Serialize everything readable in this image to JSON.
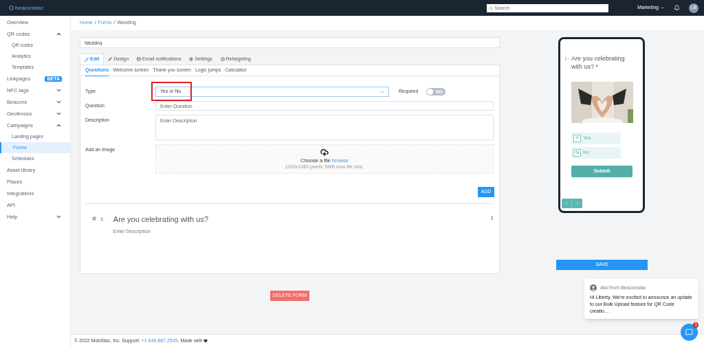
{
  "header": {
    "logo": "beaconstac",
    "search": {
      "placeholder": "Search"
    },
    "account": "Marketing",
    "avatar": "LB"
  },
  "sidebar": {
    "items": [
      {
        "label": "Overview",
        "selected": false
      },
      {
        "label": "QR codes",
        "selected": false,
        "expanded": true,
        "children": [
          {
            "label": "QR codes",
            "selected": false
          },
          {
            "label": "Analytics",
            "selected": false
          },
          {
            "label": "Templates",
            "selected": false
          }
        ]
      },
      {
        "label": "Linkpages",
        "selected": false,
        "badge": "BETA"
      },
      {
        "label": "NFC tags",
        "selected": false,
        "expanded": false
      },
      {
        "label": "Beacons",
        "selected": false,
        "expanded": false
      },
      {
        "label": "Geofences",
        "selected": false,
        "expanded": false
      },
      {
        "label": "Campaigns",
        "selected": false,
        "expanded": true,
        "children": [
          {
            "label": "Landing pages",
            "selected": false
          },
          {
            "label": "Forms",
            "selected": true
          },
          {
            "label": "Schedules",
            "selected": false
          }
        ]
      },
      {
        "label": "Asset library",
        "selected": false
      },
      {
        "label": "Places",
        "selected": false
      },
      {
        "label": "Integrations",
        "selected": false
      },
      {
        "label": "API",
        "selected": false
      },
      {
        "label": "Help",
        "selected": false,
        "expanded": false
      }
    ]
  },
  "breadcrumb": [
    {
      "label": "Home",
      "link": true
    },
    {
      "label": "/",
      "link": false
    },
    {
      "label": "Forms",
      "link": true
    },
    {
      "label": "/",
      "link": false
    },
    {
      "label": "Wedding",
      "link": false
    }
  ],
  "form_title": {
    "value": "Wedding"
  },
  "tabs": [
    {
      "label": "Edit",
      "selected": true
    },
    {
      "label": "Design",
      "selected": false
    },
    {
      "label": "Email notifications",
      "selected": false
    },
    {
      "label": "Settings",
      "selected": false
    },
    {
      "label": "Retargeting",
      "selected": false
    }
  ],
  "subtabs": [
    {
      "label": "Questions",
      "selected": true
    },
    {
      "label": "Welcome screen",
      "selected": false
    },
    {
      "label": "Thank you screen",
      "selected": false
    },
    {
      "label": "Logic jumps",
      "selected": false
    },
    {
      "label": "Calculator",
      "selected": false
    }
  ],
  "editor": {
    "type": {
      "label": "Type",
      "value": "Yes or No",
      "highlighted": true
    },
    "required": {
      "label": "Required",
      "on": false,
      "state_text": "NO"
    },
    "question": {
      "label": "Question",
      "placeholder": "Enter Question"
    },
    "description": {
      "label": "Description",
      "placeholder": "Enter Description"
    },
    "image": {
      "label": "Add an image",
      "prompt": "Choose a file",
      "link": "browse",
      "hint": "1920x1080 pixels. 5MB max file size."
    },
    "add_button": "ADD"
  },
  "questions": [
    {
      "number": "1.",
      "title": "Are you celebrating with us?",
      "description": "Enter Description"
    }
  ],
  "delete_button": "DELETE FORM",
  "preview": {
    "number": "1",
    "question": "Are you celebrating with us? *",
    "options": [
      {
        "key": "Y",
        "label": "Yes"
      },
      {
        "key": "N",
        "label": "No"
      }
    ],
    "submit": "Submit"
  },
  "save_button": "SAVE",
  "chat": {
    "sender": "Atul from Beaconstac",
    "message": "Hi Liberty, We're excited to announce an update to our Bulk Upload feature for QR Code creatio…",
    "unread": "3"
  },
  "footer": {
    "text": "© 2022 MobStac, Inc. Support: ",
    "phone": "+1 646.867.2545",
    "suffix": ". Made with"
  }
}
